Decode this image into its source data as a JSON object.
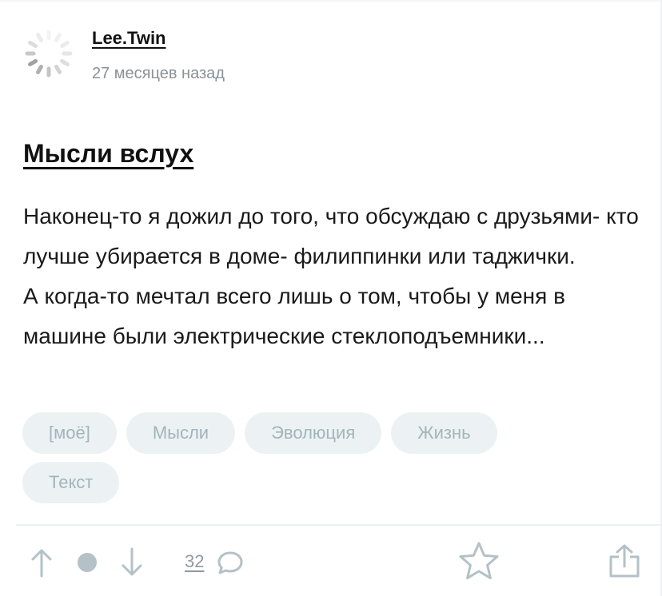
{
  "post": {
    "author": "Lee.Twin",
    "time": "27 месяцев назад",
    "title": "Мысли вслух",
    "paragraphs": [
      "Наконец-то я дожил до того, что обсуждаю с друзьями- кто лучше убирается в доме- филиппинки или таджички.",
      "А когда-то мечтал всего лишь о том, чтобы у меня в машине были электрические стеклоподъемники..."
    ],
    "tags": [
      "[моё]",
      "Мысли",
      "Эволюция",
      "Жизнь",
      "Текст"
    ]
  },
  "actions": {
    "comments_count": "32",
    "icons": [
      "arrow-up-icon",
      "rating-dot-icon",
      "arrow-down-icon",
      "comment-bubble-icon",
      "star-icon",
      "share-icon"
    ]
  },
  "colors": {
    "text": "#111111",
    "muted": "#8a9197",
    "tag_bg": "#ecf2f4",
    "tag_text": "#a3b4bb",
    "icon": "#b4c1c7"
  }
}
